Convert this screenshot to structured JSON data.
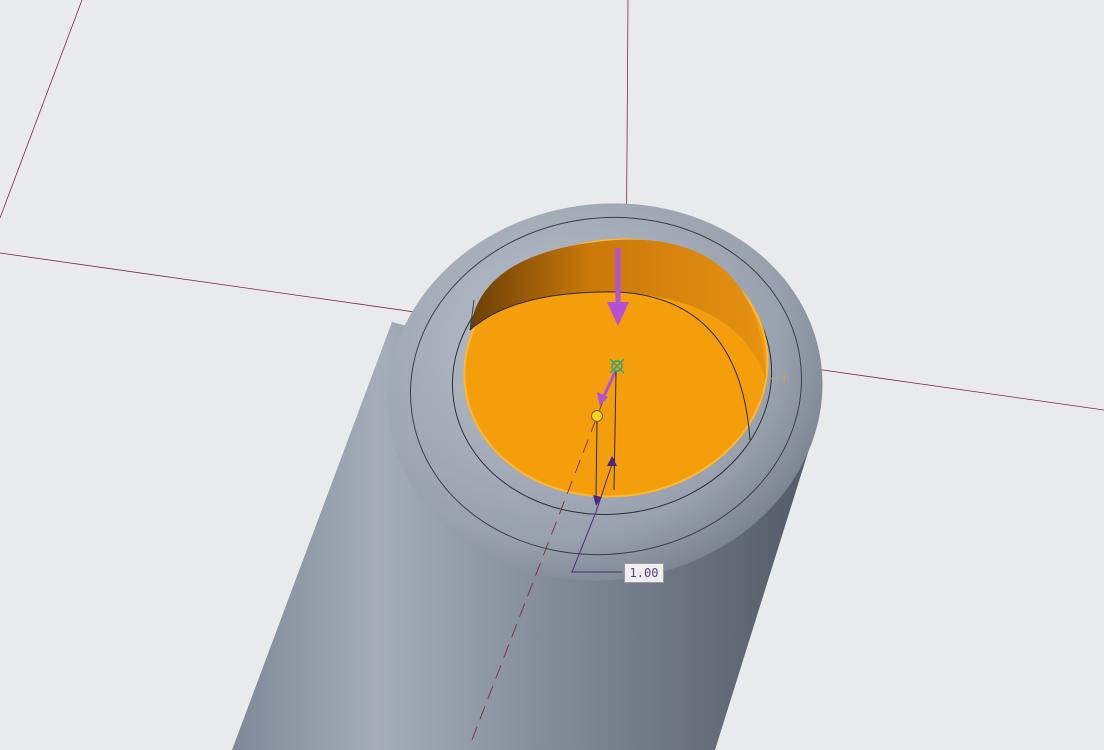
{
  "viewport": {
    "background": "#e9eaec",
    "model_color": "#9aa3af",
    "highlight_color": "#f59e0b",
    "datum_line_color": "#7a2e3e",
    "direction_arrow_color": "#b44fd8",
    "dimension_color": "#4b2a7a"
  },
  "dimension": {
    "value": "1.00"
  },
  "markers": {
    "side_marker_text": "· · I"
  },
  "icons": {
    "drag_handle": "yellow-circle-handle",
    "center_point": "green-crosshair"
  }
}
